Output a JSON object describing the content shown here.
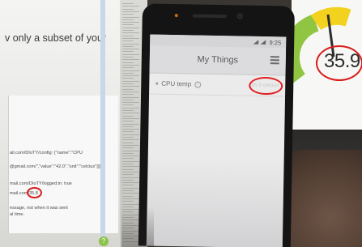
{
  "laptop": {
    "intro_text": "v only a subset of your",
    "code_lines": [
      "ail.com/DIoTY/config: {\"name\":\"CPU",
      "@gmail.com/\",\"value\":\"42.0\",\"unit\":\"celcius\"}]}",
      "mail.com/DIoTY/logged:in: true",
      "mail.com/",
      "essage, not when it was sent",
      "al time."
    ],
    "highlighted_value": "35.8",
    "help_icon": "question-icon"
  },
  "phone": {
    "status_time": "9:25",
    "app_title": "My Things",
    "menu_icon": "hamburger-menu-icon",
    "things": [
      {
        "name": "CPU temp",
        "value": "35.9 celcius"
      }
    ]
  },
  "monitor": {
    "gauge_value": "35.9",
    "gauge_colors": {
      "green": "#8fc540",
      "yellow": "#f2d21e",
      "needle": "#2e2e2e"
    }
  },
  "annotation_color": "#e01d1d"
}
